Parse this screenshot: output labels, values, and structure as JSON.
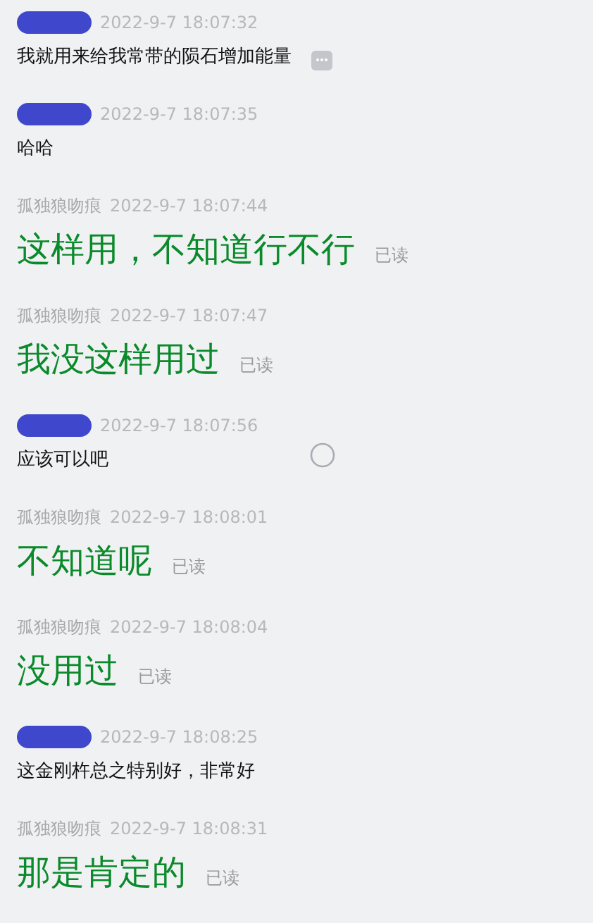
{
  "messages": [
    {
      "kind": "incoming",
      "sender_redacted": true,
      "time": "2022-9-7 18:07:32",
      "text": "我就用来给我常带的陨石增加能量",
      "more_button": true
    },
    {
      "kind": "incoming",
      "sender_redacted": true,
      "time": "2022-9-7 18:07:35",
      "text": "哈哈"
    },
    {
      "kind": "outgoing",
      "sender": "孤独狼吻痕",
      "time": "2022-9-7 18:07:44",
      "text": "这样用，不知道行不行",
      "status": "已读"
    },
    {
      "kind": "outgoing",
      "sender": "孤独狼吻痕",
      "time": "2022-9-7 18:07:47",
      "text": "我没这样用过",
      "status": "已读"
    },
    {
      "kind": "incoming",
      "sender_redacted": true,
      "time": "2022-9-7 18:07:56",
      "text": "应该可以吧"
    },
    {
      "kind": "outgoing",
      "sender": "孤独狼吻痕",
      "time": "2022-9-7 18:08:01",
      "text": "不知道呢",
      "status": "已读"
    },
    {
      "kind": "outgoing",
      "sender": "孤独狼吻痕",
      "time": "2022-9-7 18:08:04",
      "text": "没用过",
      "status": "已读"
    },
    {
      "kind": "incoming",
      "sender_redacted": true,
      "time": "2022-9-7 18:08:25",
      "text": "这金刚杵总之特别好，非常好"
    },
    {
      "kind": "outgoing",
      "sender": "孤独狼吻痕",
      "time": "2022-9-7 18:08:31",
      "text": "那是肯定的",
      "status": "已读"
    }
  ]
}
